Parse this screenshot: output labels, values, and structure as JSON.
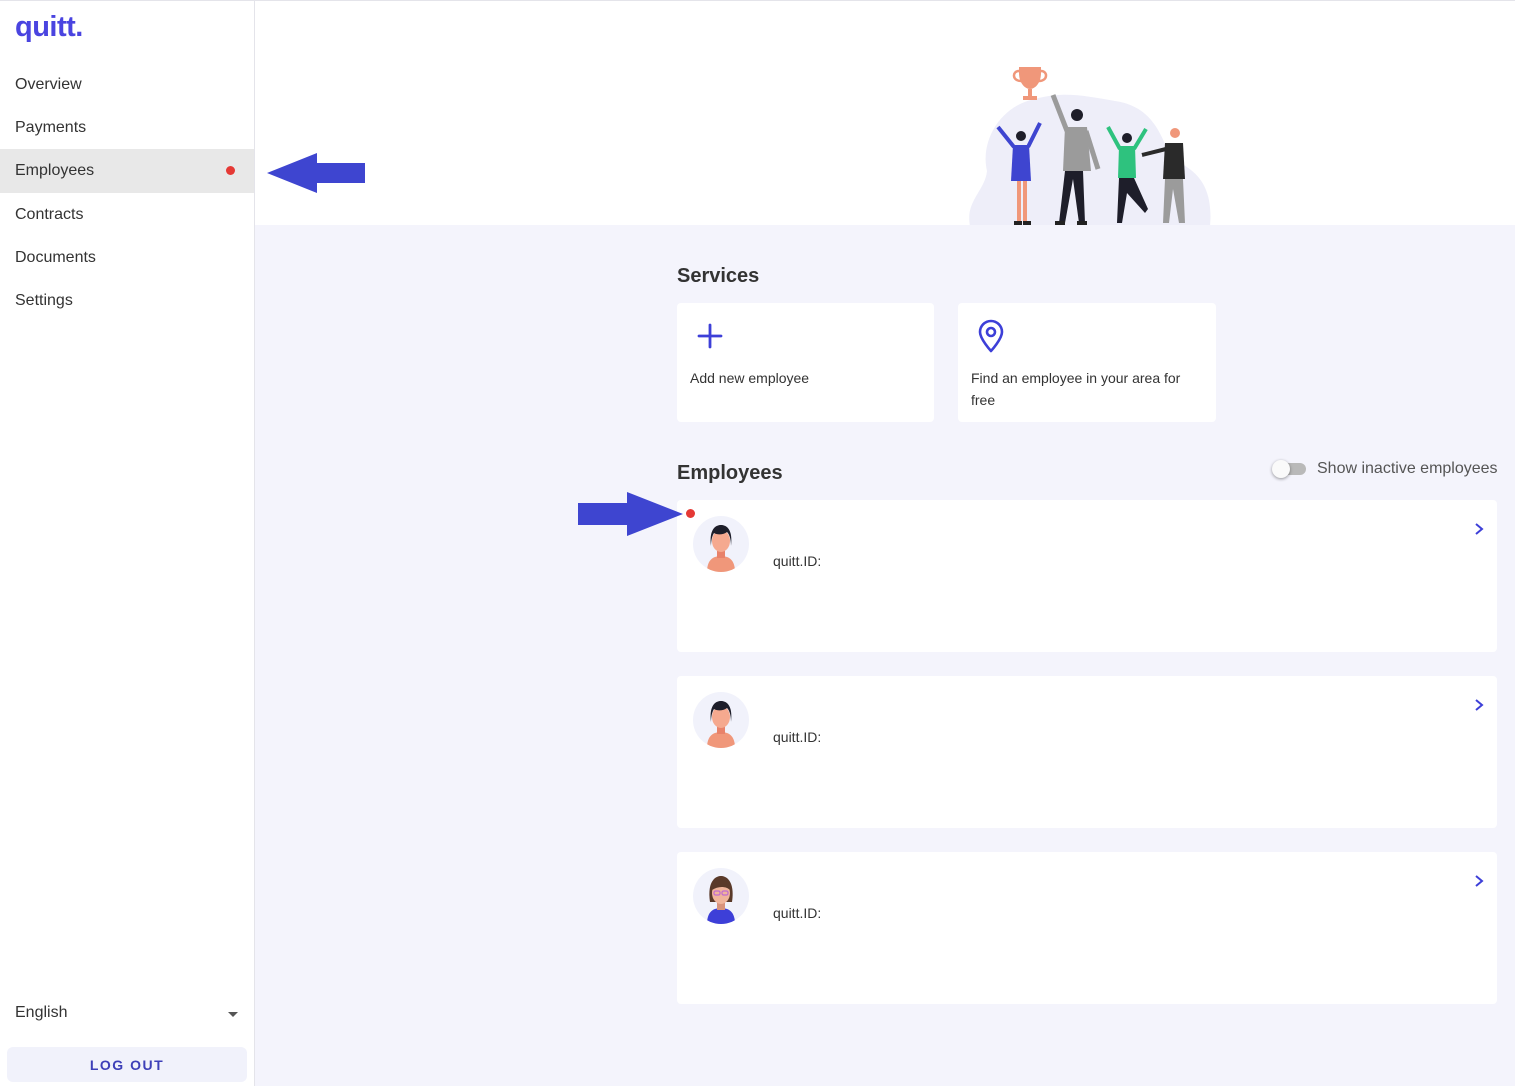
{
  "app": {
    "logo": "quitt.",
    "brand_color": "#4a44e0",
    "accent_color": "#3d3fb8",
    "alert_color": "#e53935"
  },
  "sidebar": {
    "items": [
      {
        "label": "Overview",
        "active": false
      },
      {
        "label": "Payments",
        "active": false
      },
      {
        "label": "Employees",
        "active": true,
        "has_notification": true
      },
      {
        "label": "Contracts",
        "active": false
      },
      {
        "label": "Documents",
        "active": false
      },
      {
        "label": "Settings",
        "active": false
      }
    ],
    "language": "English",
    "logout_label": "LOG OUT"
  },
  "services": {
    "title": "Services",
    "cards": [
      {
        "icon": "plus-icon",
        "label": "Add new employee"
      },
      {
        "icon": "location-pin-icon",
        "label_line1": "Find an employee in your area for",
        "label_line2": "free"
      }
    ]
  },
  "employees": {
    "title": "Employees",
    "toggle_label": "Show inactive employees",
    "toggle_on": false,
    "list": [
      {
        "id_label": "quitt.ID:",
        "avatar": "female-avatar-dark-hair",
        "has_notification": true
      },
      {
        "id_label": "quitt.ID:",
        "avatar": "female-avatar-dark-hair",
        "has_notification": false
      },
      {
        "id_label": "quitt.ID:",
        "avatar": "female-avatar-glasses",
        "has_notification": false
      }
    ]
  },
  "annotations": {
    "arrow_color": "#3e45d0"
  }
}
